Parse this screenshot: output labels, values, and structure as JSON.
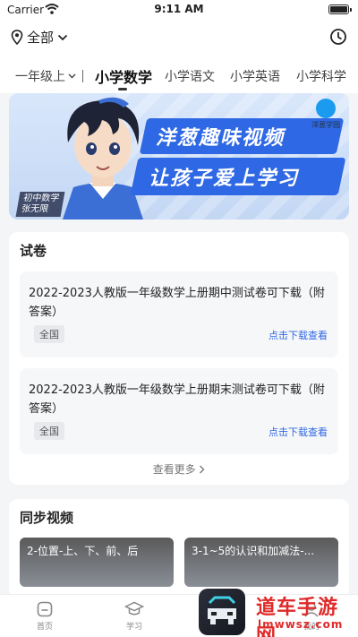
{
  "status_bar": {
    "carrier": "Carrier",
    "time": "9:11 AM"
  },
  "top_bar": {
    "location": "全部"
  },
  "tabs": {
    "grade": "一年级上",
    "subjects": [
      "小学数学",
      "小学语文",
      "小学英语",
      "小学科学"
    ],
    "active_index": 0
  },
  "banner": {
    "headline_1": "洋葱趣味视频",
    "headline_2": "让孩子爱上学习",
    "brand": "洋葱学园",
    "tag_line_1": "初中数学",
    "tag_line_2": "张无限"
  },
  "exams": {
    "title": "试卷",
    "items": [
      {
        "title": "2022-2023人教版一年级数学上册期中测试卷可下载（附答案）",
        "badge": "全国",
        "link": "点击下载查看"
      },
      {
        "title": "2022-2023人教版一年级数学上册期末测试卷可下载（附答案）",
        "badge": "全国",
        "link": "点击下载查看"
      }
    ],
    "more": "查看更多"
  },
  "videos": {
    "title": "同步视频",
    "items": [
      {
        "title": "2-位置-上、下、前、后"
      },
      {
        "title": "3-1~5的认识和加减法-..."
      }
    ]
  },
  "bottom_nav": {
    "items": [
      "首页",
      "学习",
      "我的"
    ]
  },
  "watermark": {
    "text": "道车手游网",
    "url": "lmwwsz.com"
  }
}
